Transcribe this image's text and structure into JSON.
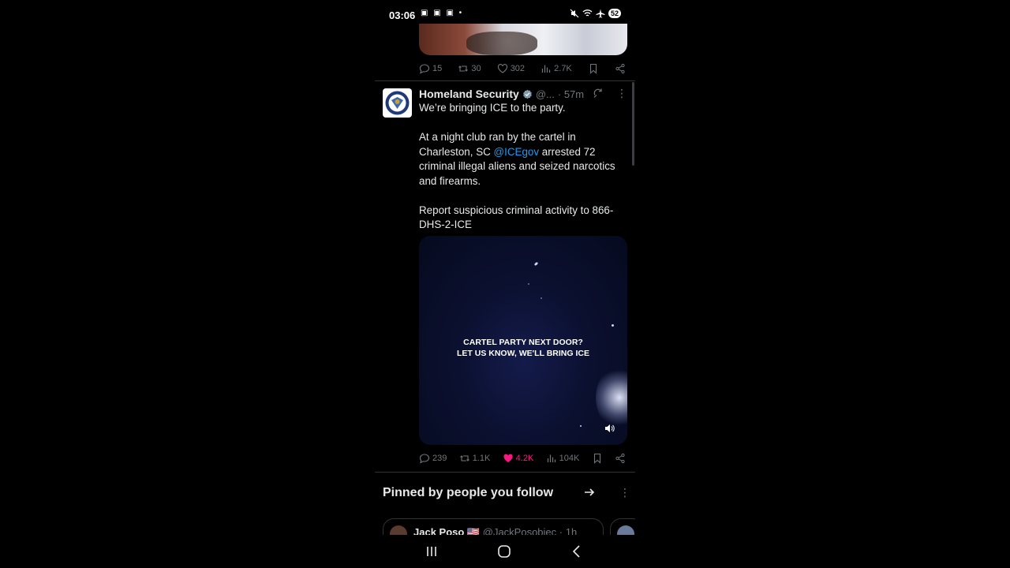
{
  "status_bar": {
    "time": "03:06",
    "left_indicators": "▣ ▣ ▣ •",
    "battery": "52"
  },
  "prev_tweet": {
    "replies": "15",
    "reposts": "30",
    "likes": "302",
    "views": "2.7K"
  },
  "tweet": {
    "name": "Homeland Security",
    "handle": "@...",
    "time": "· 57m",
    "more": "⋮",
    "line1": "We’re bringing ICE to the party.",
    "line2a": "At a night club ran by the cartel in Charleston, SC ",
    "mention": "@ICEgov",
    "line2b": " arrested 72 criminal illegal aliens and seized narcotics and firearms.",
    "line3": "Report suspicious criminal activity to 866-DHS-2-ICE",
    "video_caption_1": "CARTEL PARTY NEXT DOOR?",
    "video_caption_2": "LET US KNOW, WE'LL BRING ICE",
    "replies": "239",
    "reposts": "1.1K",
    "likes": "4.2K",
    "views": "104K",
    "like_color": "#f91880",
    "link_color": "#1d9bf0"
  },
  "pinned": {
    "title": "Pinned by people you follow",
    "more": "⋮",
    "card_name": "Jack Poso 🇺🇸",
    "card_handle": "@JackPosobiec · 1h"
  }
}
